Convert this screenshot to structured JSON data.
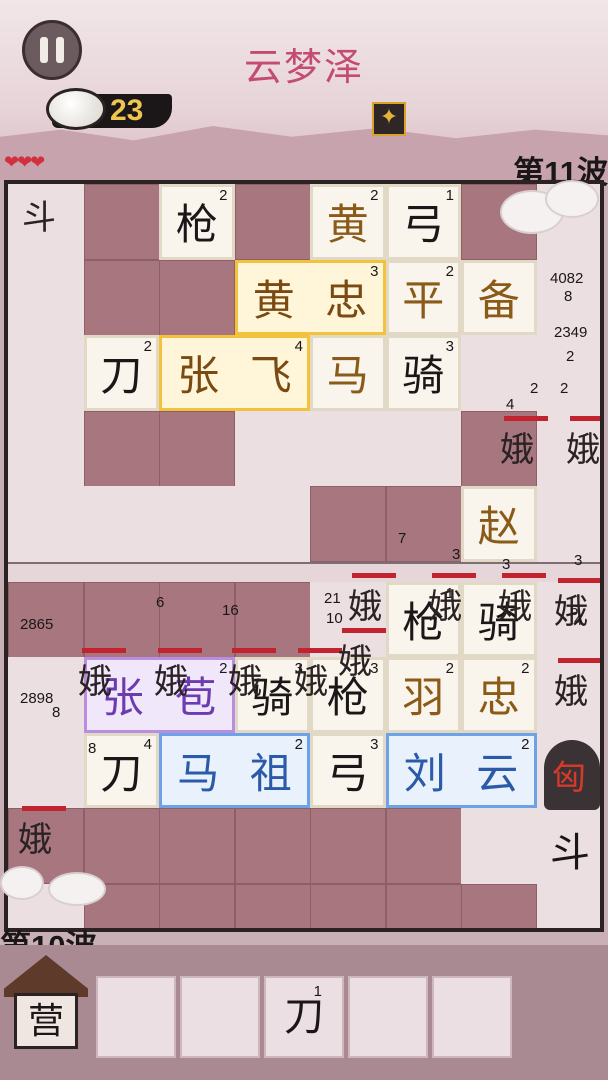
{
  "hud": {
    "level_title": "云梦泽",
    "currency": "23",
    "wave_top": "第11波",
    "wave_bottom": "第10波",
    "hearts": "❤❤❤"
  },
  "tiles": [
    {
      "name": "tile-qiang-top",
      "chars": [
        "枪"
      ],
      "level": "2",
      "style": "plain"
    },
    {
      "name": "tile-huang-top",
      "chars": [
        "黄"
      ],
      "level": "2",
      "style": "brown"
    },
    {
      "name": "tile-gong",
      "chars": [
        "弓"
      ],
      "level": "1",
      "style": "plain"
    },
    {
      "name": "tile-huang-zhong",
      "chars": [
        "黄",
        "忠"
      ],
      "level": "3",
      "style": "gold"
    },
    {
      "name": "tile-ping",
      "chars": [
        "平"
      ],
      "level": "2",
      "style": "brown"
    },
    {
      "name": "tile-bei",
      "chars": [
        "备"
      ],
      "level": "",
      "style": "brown"
    },
    {
      "name": "tile-dao-1",
      "chars": [
        "刀"
      ],
      "level": "2",
      "style": "plain"
    },
    {
      "name": "tile-zhang-fei",
      "chars": [
        "张",
        "飞"
      ],
      "level": "4",
      "style": "gold"
    },
    {
      "name": "tile-ma-1",
      "chars": [
        "马"
      ],
      "level": "",
      "style": "brown"
    },
    {
      "name": "tile-qi-1",
      "chars": [
        "骑"
      ],
      "level": "3",
      "style": "plain"
    },
    {
      "name": "tile-zhao",
      "chars": [
        "赵"
      ],
      "level": "",
      "style": "brown"
    },
    {
      "name": "tile-qiang-mid",
      "chars": [
        "枪"
      ],
      "level": "1",
      "style": "plain"
    },
    {
      "name": "tile-qi-2",
      "chars": [
        "骑"
      ],
      "level": "",
      "style": "plain"
    },
    {
      "name": "tile-zhang-bao",
      "chars": [
        "张",
        "苞"
      ],
      "level": "2",
      "style": "purple"
    },
    {
      "name": "tile-qi-3",
      "chars": [
        "骑"
      ],
      "level": "3",
      "style": "plain"
    },
    {
      "name": "tile-qiang-low",
      "chars": [
        "枪"
      ],
      "level": "3",
      "style": "plain"
    },
    {
      "name": "tile-yu",
      "chars": [
        "羽"
      ],
      "level": "2",
      "style": "brown"
    },
    {
      "name": "tile-zhong",
      "chars": [
        "忠"
      ],
      "level": "2",
      "style": "brown"
    },
    {
      "name": "tile-dao-2",
      "chars": [
        "刀"
      ],
      "level": "4",
      "style": "plain"
    },
    {
      "name": "tile-ma-zu",
      "chars": [
        "马",
        "祖"
      ],
      "level": "2",
      "style": "blue"
    },
    {
      "name": "tile-gong-low",
      "chars": [
        "弓"
      ],
      "level": "3",
      "style": "plain"
    },
    {
      "name": "tile-liu-yun",
      "chars": [
        "刘",
        "云"
      ],
      "level": "2",
      "style": "blue"
    }
  ],
  "enemies": {
    "e_label": "娥",
    "dou_label": "斗",
    "boss_label": "匈"
  },
  "numbers": [
    "4082",
    "8",
    "2349",
    "2",
    "2",
    "4",
    "2",
    "7",
    "3",
    "3",
    "3",
    "21",
    "10",
    "6",
    "16",
    "2865",
    "2898",
    "8",
    "8",
    "6",
    "4"
  ],
  "camp": {
    "label": "营"
  },
  "slots": [
    {
      "char": "",
      "level": ""
    },
    {
      "char": "",
      "level": ""
    },
    {
      "char": "刀",
      "level": "1"
    },
    {
      "char": "",
      "level": ""
    },
    {
      "char": "",
      "level": ""
    }
  ]
}
